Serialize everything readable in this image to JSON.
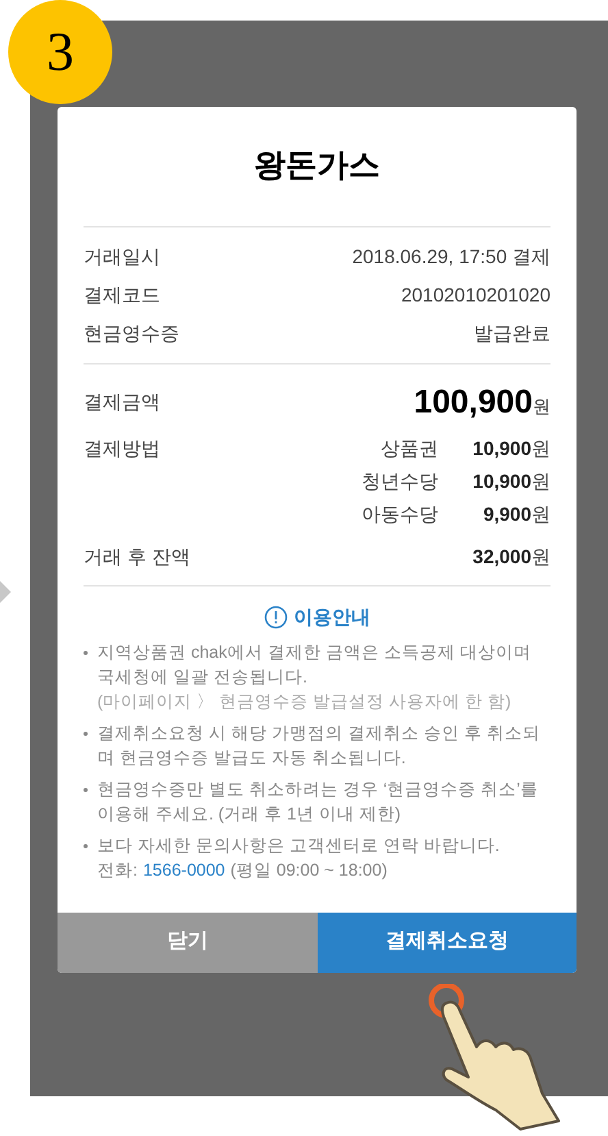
{
  "step_badge": "3",
  "receipt": {
    "title": "왕돈가스",
    "details": [
      {
        "label": "거래일시",
        "value": "2018.06.29, 17:50 결제"
      },
      {
        "label": "결제코드",
        "value": "20102010201020"
      },
      {
        "label": "현금영수증",
        "value": "발급완료"
      }
    ],
    "amount": {
      "label": "결제금액",
      "value": "100,900",
      "unit": "원"
    },
    "methods": {
      "label": "결제방법",
      "items": [
        {
          "name": "상품권",
          "value": "10,900",
          "unit": "원"
        },
        {
          "name": "청년수당",
          "value": "10,900",
          "unit": "원"
        },
        {
          "name": "아동수당",
          "value": "9,900",
          "unit": "원"
        }
      ]
    },
    "balance": {
      "label": "거래 후 잔액",
      "value": "32,000",
      "unit": "원"
    }
  },
  "guide": {
    "title": "이용안내",
    "notes": [
      {
        "text": "지역상품권 chak에서 결제한 금액은 소득공제 대상이며 국세청에 일괄 전송됩니다.",
        "sub": "(마이페이지 〉 현금영수증 발급설정 사용자에 한 함)"
      },
      {
        "text": "결제취소요청 시 해당 가맹점의 결제취소 승인 후 취소되며 현금영수증 발급도 자동 취소됩니다."
      },
      {
        "text": "현금영수증만 별도 취소하려는 경우 ‘현금영수증 취소’를 이용해 주세요. (거래 후 1년 이내 제한)"
      },
      {
        "text": "보다 자세한 문의사항은 고객센터로 연락 바랍니다.",
        "phone_label": "전화:",
        "phone": "1566-0000",
        "hours": "(평일 09:00 ~ 18:00)"
      }
    ]
  },
  "buttons": [
    {
      "label": "닫기",
      "kind": "secondary"
    },
    {
      "label": "결제취소요청",
      "kind": "primary"
    }
  ]
}
